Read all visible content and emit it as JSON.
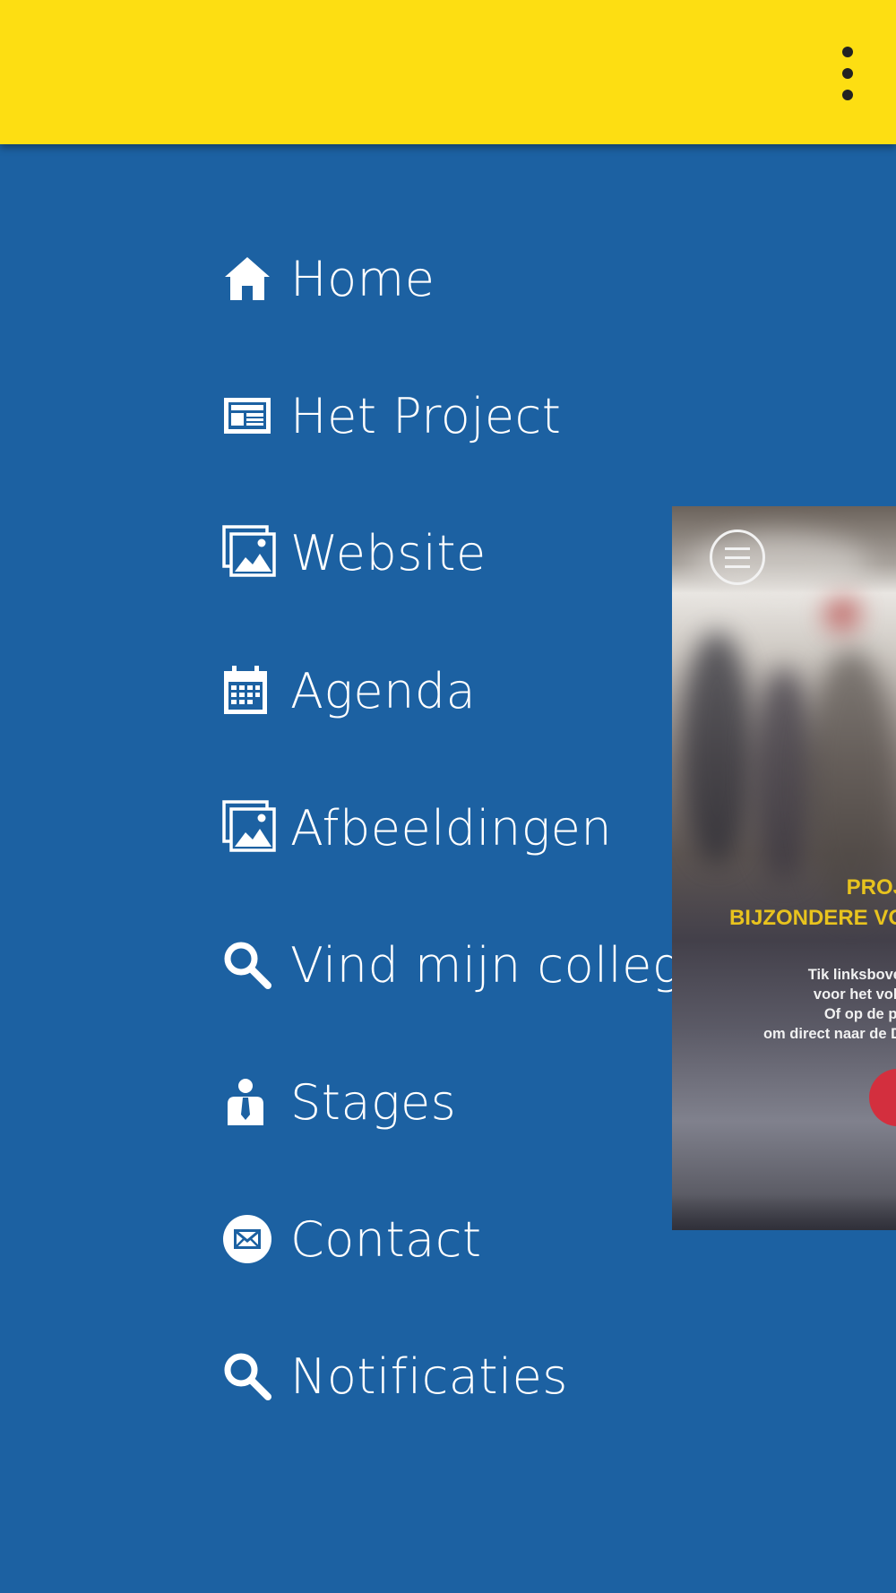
{
  "appbar": {
    "overflow_icon": "more-vert-icon",
    "color": "#fdde12"
  },
  "menu": {
    "background": "#1c61a2",
    "items": [
      {
        "label": "Home",
        "icon": "home-icon"
      },
      {
        "label": "Het Project",
        "icon": "newspaper-icon"
      },
      {
        "label": "Website",
        "icon": "images-icon"
      },
      {
        "label": "Agenda",
        "icon": "calendar-icon"
      },
      {
        "label": "Afbeeldingen",
        "icon": "images-icon"
      },
      {
        "label": "Vind mijn collega",
        "icon": "search-icon"
      },
      {
        "label": "Stages",
        "icon": "person-tie-icon"
      },
      {
        "label": "Contact",
        "icon": "envelope-icon"
      },
      {
        "label": "Notificaties",
        "icon": "search-icon"
      }
    ]
  },
  "preview": {
    "title_line1": "PROJ",
    "title_line2": "BIJZONDERE VO",
    "sub_line1": "Tik linksbove",
    "sub_line2": "voor het voll",
    "sub_line3": "Of op de pi",
    "sub_line4": "om direct naar de D"
  }
}
